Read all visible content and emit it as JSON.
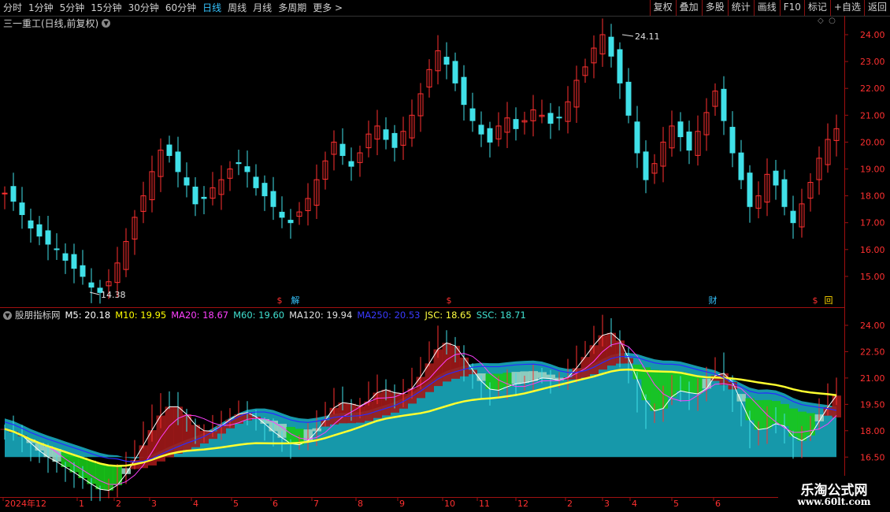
{
  "toolbar": {
    "periods": [
      "分时",
      "1分钟",
      "5分钟",
      "15分钟",
      "30分钟",
      "60分钟",
      "日线",
      "周线",
      "月线",
      "多周期",
      "更多 >"
    ],
    "active": "日线",
    "buttons": [
      "复权",
      "叠加",
      "多股",
      "统计",
      "画线",
      "F10",
      "标记",
      "+自选",
      "返回"
    ]
  },
  "chart_title": "三一重工(日线,前复权)",
  "price_axis": [
    "24.00",
    "23.00",
    "22.00",
    "21.00",
    "20.00",
    "19.00",
    "18.00",
    "17.00",
    "16.00",
    "15.00"
  ],
  "high_label": "24.11",
  "low_label": "14.38",
  "event_markers": [
    {
      "text": "$",
      "color": "#ff3030"
    },
    {
      "text": "解",
      "color": "#35c4ff"
    },
    {
      "text": "$",
      "color": "#ff3030"
    },
    {
      "text": "财",
      "color": "#35c4ff"
    },
    {
      "text": "$",
      "color": "#ff3030"
    },
    {
      "text": "回",
      "color": "#ffd700"
    }
  ],
  "indicator": {
    "name": "股朋指标网",
    "items": [
      {
        "text": "M5: 20.18",
        "color": "#ffffff"
      },
      {
        "text": "M10: 19.95",
        "color": "#ffff00"
      },
      {
        "text": "MA20: 18.67",
        "color": "#ff40ff"
      },
      {
        "text": "M60: 19.60",
        "color": "#40e0d0"
      },
      {
        "text": "MA120: 19.94",
        "color": "#e0e0e0"
      },
      {
        "text": "MA250: 20.53",
        "color": "#3a3aff"
      },
      {
        "text": "JSC: 18.65",
        "color": "#ffff40"
      },
      {
        "text": "SSC: 18.71",
        "color": "#40e0d0"
      }
    ],
    "axis": [
      "24.00",
      "22.50",
      "21.00",
      "19.50",
      "18.00",
      "16.50"
    ]
  },
  "date_axis": [
    "2024年12",
    "1",
    "2",
    "3",
    "4",
    "5",
    "6",
    "7",
    "8",
    "9",
    "10",
    "11",
    "12",
    "2",
    "3",
    "4",
    "5",
    "6"
  ],
  "watermark": {
    "line1": "乐淘公式网",
    "line2": "www.60lt.com"
  },
  "chart_data": {
    "type": "candlestick",
    "title": "三一重工(日线,前复权)",
    "price_range": [
      14.38,
      24.11
    ],
    "closes": [
      18.1,
      17.8,
      17.3,
      16.8,
      16.5,
      16.2,
      16.0,
      15.6,
      15.3,
      15.0,
      14.6,
      14.4,
      14.8,
      15.5,
      16.3,
      17.2,
      18.0,
      18.9,
      19.7,
      19.5,
      18.9,
      18.4,
      17.7,
      17.9,
      18.3,
      18.6,
      19.0,
      19.2,
      18.9,
      18.3,
      18.0,
      17.6,
      17.2,
      17.0,
      17.4,
      17.9,
      18.6,
      19.3,
      20.0,
      19.5,
      19.1,
      19.6,
      20.3,
      20.6,
      20.1,
      19.8,
      20.4,
      21.0,
      21.8,
      22.7,
      23.4,
      22.9,
      22.2,
      21.4,
      20.8,
      20.3,
      20.0,
      20.6,
      20.9,
      20.5,
      20.8,
      21.2,
      21.0,
      20.7,
      20.9,
      21.5,
      22.3,
      22.8,
      23.5,
      24.0,
      23.2,
      22.2,
      21.0,
      19.6,
      18.6,
      19.2,
      20.0,
      20.6,
      20.2,
      19.7,
      20.4,
      21.1,
      21.9,
      20.8,
      19.6,
      18.6,
      17.6,
      18.0,
      18.8,
      18.4,
      17.6,
      17.0,
      17.7,
      18.5,
      19.4,
      20.1,
      20.5
    ]
  }
}
